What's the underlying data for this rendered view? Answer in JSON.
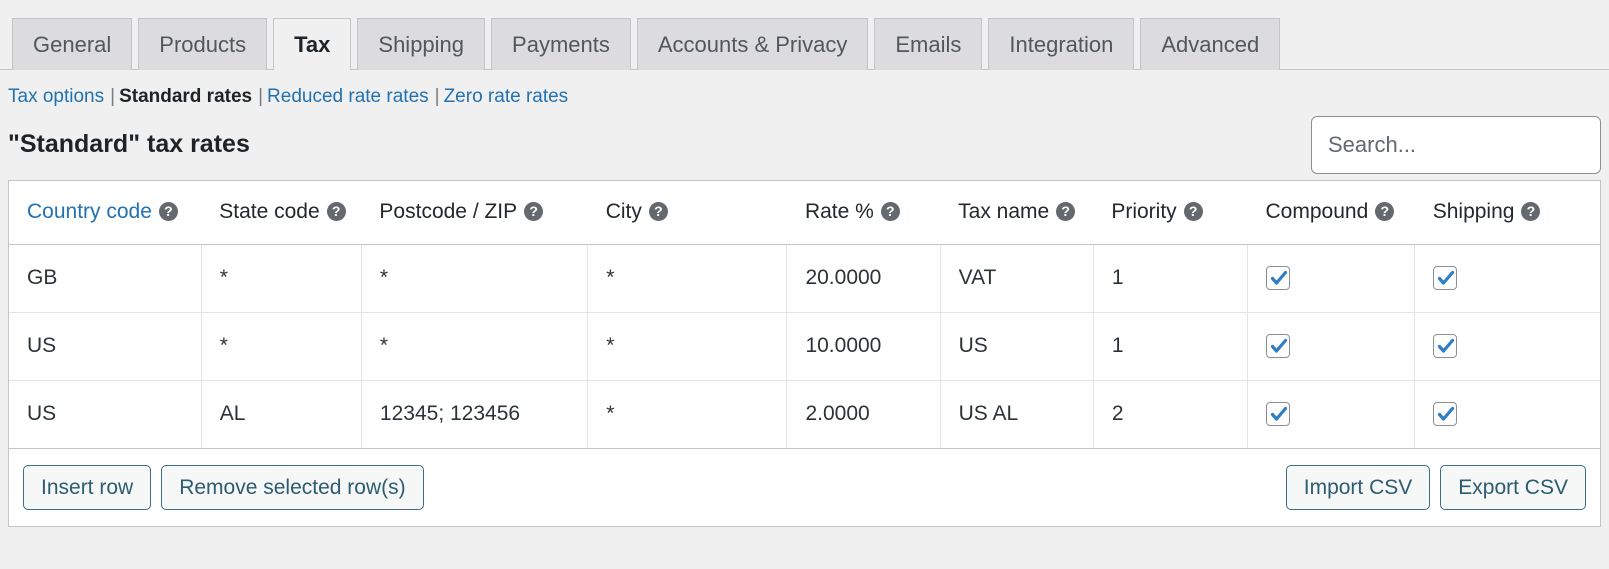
{
  "tabs": [
    {
      "label": "General",
      "active": false
    },
    {
      "label": "Products",
      "active": false
    },
    {
      "label": "Tax",
      "active": true
    },
    {
      "label": "Shipping",
      "active": false
    },
    {
      "label": "Payments",
      "active": false
    },
    {
      "label": "Accounts & Privacy",
      "active": false
    },
    {
      "label": "Emails",
      "active": false
    },
    {
      "label": "Integration",
      "active": false
    },
    {
      "label": "Advanced",
      "active": false
    }
  ],
  "subnav": {
    "items": [
      {
        "label": "Tax options",
        "current": false
      },
      {
        "label": "Standard rates",
        "current": true
      },
      {
        "label": "Reduced rate rates",
        "current": false
      },
      {
        "label": "Zero rate rates",
        "current": false
      }
    ],
    "separator": "|"
  },
  "page_title": "\"Standard\" tax rates",
  "search": {
    "placeholder": "Search...",
    "value": ""
  },
  "table": {
    "columns": [
      {
        "label": "Country code",
        "help": "?",
        "is_link": true
      },
      {
        "label": "State code",
        "help": "?",
        "is_link": false
      },
      {
        "label": "Postcode / ZIP",
        "help": "?",
        "is_link": false
      },
      {
        "label": "City",
        "help": "?",
        "is_link": false
      },
      {
        "label": "Rate %",
        "help": "?",
        "is_link": false
      },
      {
        "label": "Tax name",
        "help": "?",
        "is_link": false
      },
      {
        "label": "Priority",
        "help": "?",
        "is_link": false
      },
      {
        "label": "Compound",
        "help": "?",
        "is_link": false
      },
      {
        "label": "Shipping",
        "help": "?",
        "is_link": false
      }
    ],
    "rows": [
      {
        "country_code": "GB",
        "state_code": "*",
        "postcode": "*",
        "city": "*",
        "rate": "20.0000",
        "tax_name": "VAT",
        "priority": "1",
        "compound": true,
        "shipping": true
      },
      {
        "country_code": "US",
        "state_code": "*",
        "postcode": "*",
        "city": "*",
        "rate": "10.0000",
        "tax_name": "US",
        "priority": "1",
        "compound": true,
        "shipping": true
      },
      {
        "country_code": "US",
        "state_code": "AL",
        "postcode": "12345; 123456",
        "city": "*",
        "rate": "2.0000",
        "tax_name": "US AL",
        "priority": "2",
        "compound": true,
        "shipping": true
      }
    ]
  },
  "footer": {
    "insert_row": "Insert row",
    "remove_rows": "Remove selected row(s)",
    "import_csv": "Import CSV",
    "export_csv": "Export CSV"
  },
  "colors": {
    "link": "#2271b1",
    "checkbox_check": "#2f7ec4",
    "button_border": "#3f6e7d",
    "page_bg": "#f0f0f1"
  }
}
